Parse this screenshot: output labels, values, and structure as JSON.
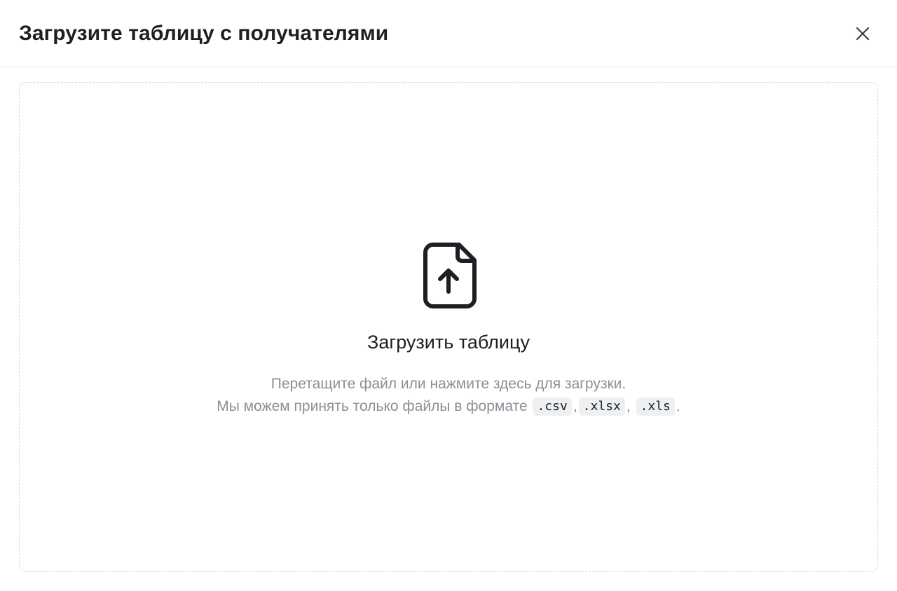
{
  "modal": {
    "title": "Загрузите таблицу с получателями",
    "close_icon": "close-icon"
  },
  "dropzone": {
    "icon": "file-upload-icon",
    "title": "Загрузить таблицу",
    "line1": "Перетащите файл или нажмите здесь для загрузки.",
    "line2_prefix": "Мы можем принять только файлы в формате",
    "formats": [
      ".csv",
      ".xlsx",
      ".xls"
    ],
    "sep1": ",",
    "sep2": ",",
    "end": "."
  },
  "colors": {
    "text_primary": "#1c1f23",
    "text_secondary": "#8a9097",
    "border": "#d3d6da",
    "code_bg": "#eef0f2"
  }
}
